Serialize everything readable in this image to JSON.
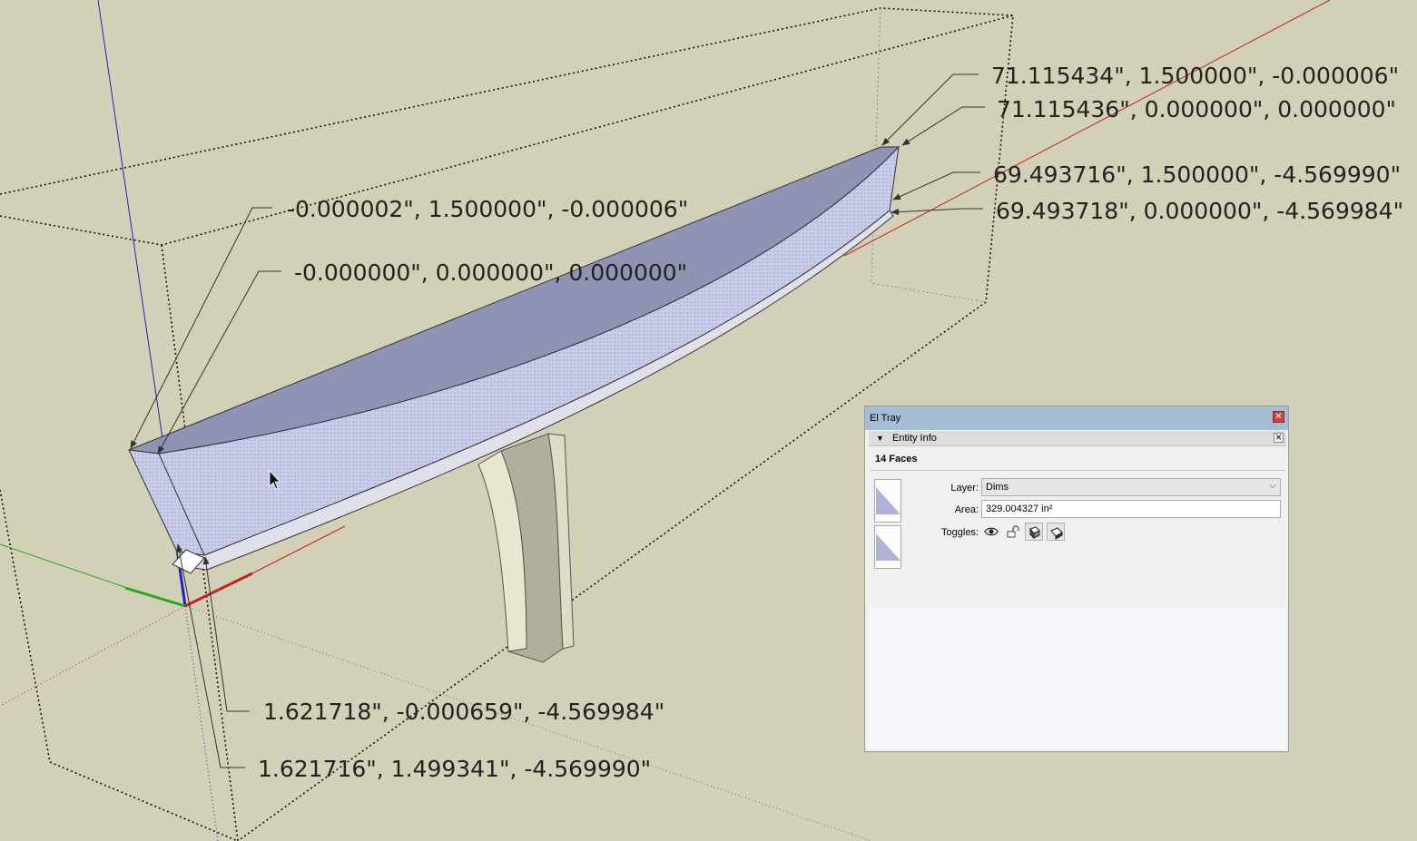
{
  "viewport": {
    "background": "#d2d0b7",
    "face_color": "#c7cbe7",
    "axes": {
      "red": "#c22222",
      "green": "#22aa22",
      "blue": "#2222bb"
    },
    "dimension_labels": [
      {
        "id": "top-end-outer",
        "text": "71.115434\", 1.500000\", -0.000006\""
      },
      {
        "id": "top-end-inner",
        "text": "71.115436\", 0.000000\", 0.000000\""
      },
      {
        "id": "bottom-end-outer",
        "text": "69.493716\", 1.500000\", -4.569990\""
      },
      {
        "id": "bottom-end-inner",
        "text": "69.493718\", 0.000000\", -4.569984\""
      },
      {
        "id": "left-top-outer",
        "text": "-0.000002\", 1.500000\", -0.000006\""
      },
      {
        "id": "left-top-origin",
        "text": "-0.000000\", 0.000000\", 0.000000\""
      },
      {
        "id": "left-bottom-inner",
        "text": "1.621718\", -0.000659\", -4.569984\""
      },
      {
        "id": "left-bottom-outer",
        "text": "1.621716\", 1.499341\", -4.569990\""
      }
    ]
  },
  "tray": {
    "title": "El Tray",
    "close_icon": "close-icon",
    "section": {
      "title": "Entity Info",
      "expanded": true
    },
    "selection_summary": "14 Faces",
    "layer": {
      "label": "Layer:",
      "value": "Dims"
    },
    "area": {
      "label": "Area:",
      "value": "329.004327 in²"
    },
    "toggles": {
      "label": "Toggles:",
      "items": [
        {
          "icon": "eye-icon",
          "state": "off"
        },
        {
          "icon": "lock-icon",
          "state": "off"
        },
        {
          "icon": "cast-shadow-icon",
          "state": "on"
        },
        {
          "icon": "receive-shadow-icon",
          "state": "on"
        }
      ]
    }
  }
}
